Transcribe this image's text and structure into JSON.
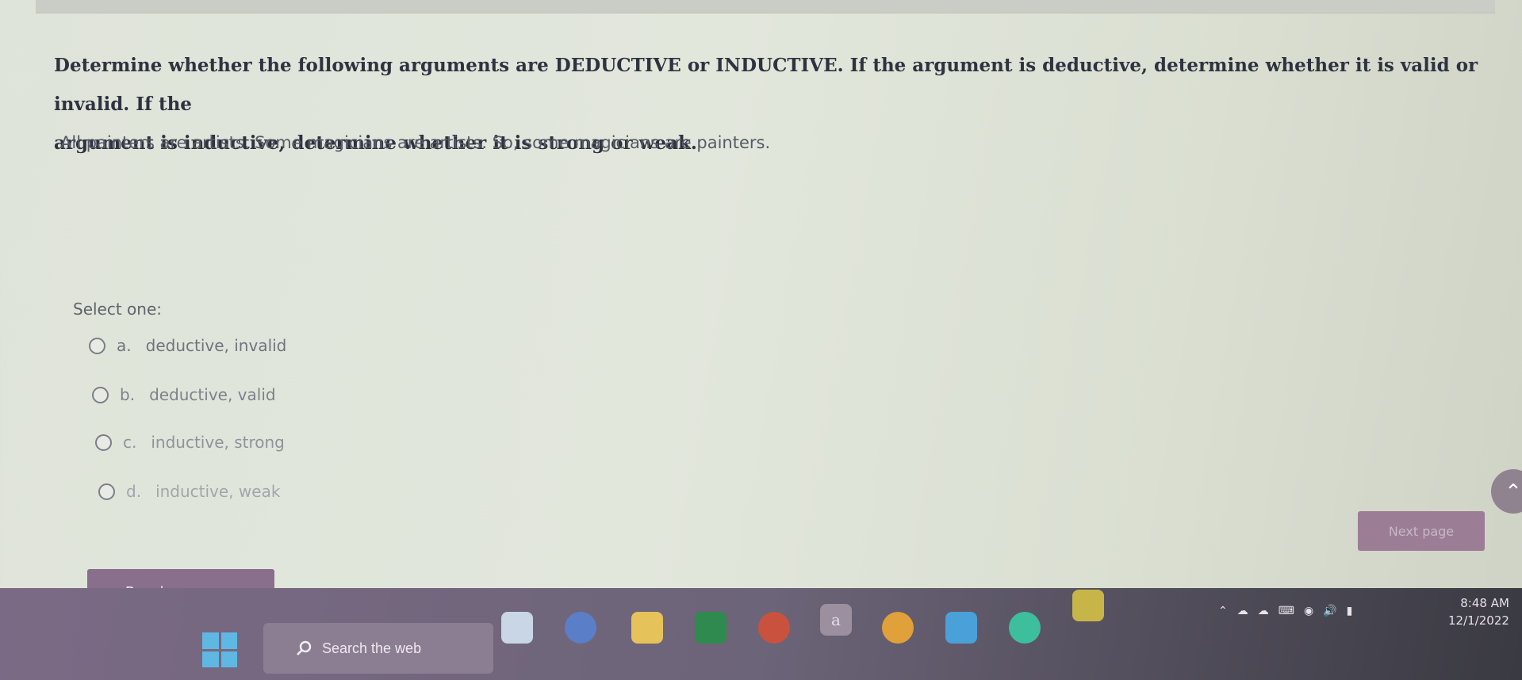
{
  "question": {
    "line1": "Determine whether the following arguments are DEDUCTIVE or INDUCTIVE. If the argument is deductive, determine whether it is valid or invalid. If the",
    "line2": "argument is inductive, determine whether it is strong or weak.",
    "argument": "All painters are artists. Some magicians are artists. So, some magicians are painters."
  },
  "answer": {
    "select_label": "Select one:",
    "options": [
      {
        "letter": "a.",
        "text": "deductive, invalid"
      },
      {
        "letter": "b.",
        "text": "deductive, valid"
      },
      {
        "letter": "c.",
        "text": "inductive, strong"
      },
      {
        "letter": "d.",
        "text": "inductive, weak"
      }
    ]
  },
  "nav": {
    "previous_label": "Previous page",
    "next_label": "Next page"
  },
  "taskbar": {
    "search_label": "Search the web",
    "clock_time": "8:48 AM",
    "clock_date": "12/1/2022"
  },
  "colors": {
    "button_purple": "#8a6f8c",
    "windows_blue": "#5fb8e2"
  }
}
